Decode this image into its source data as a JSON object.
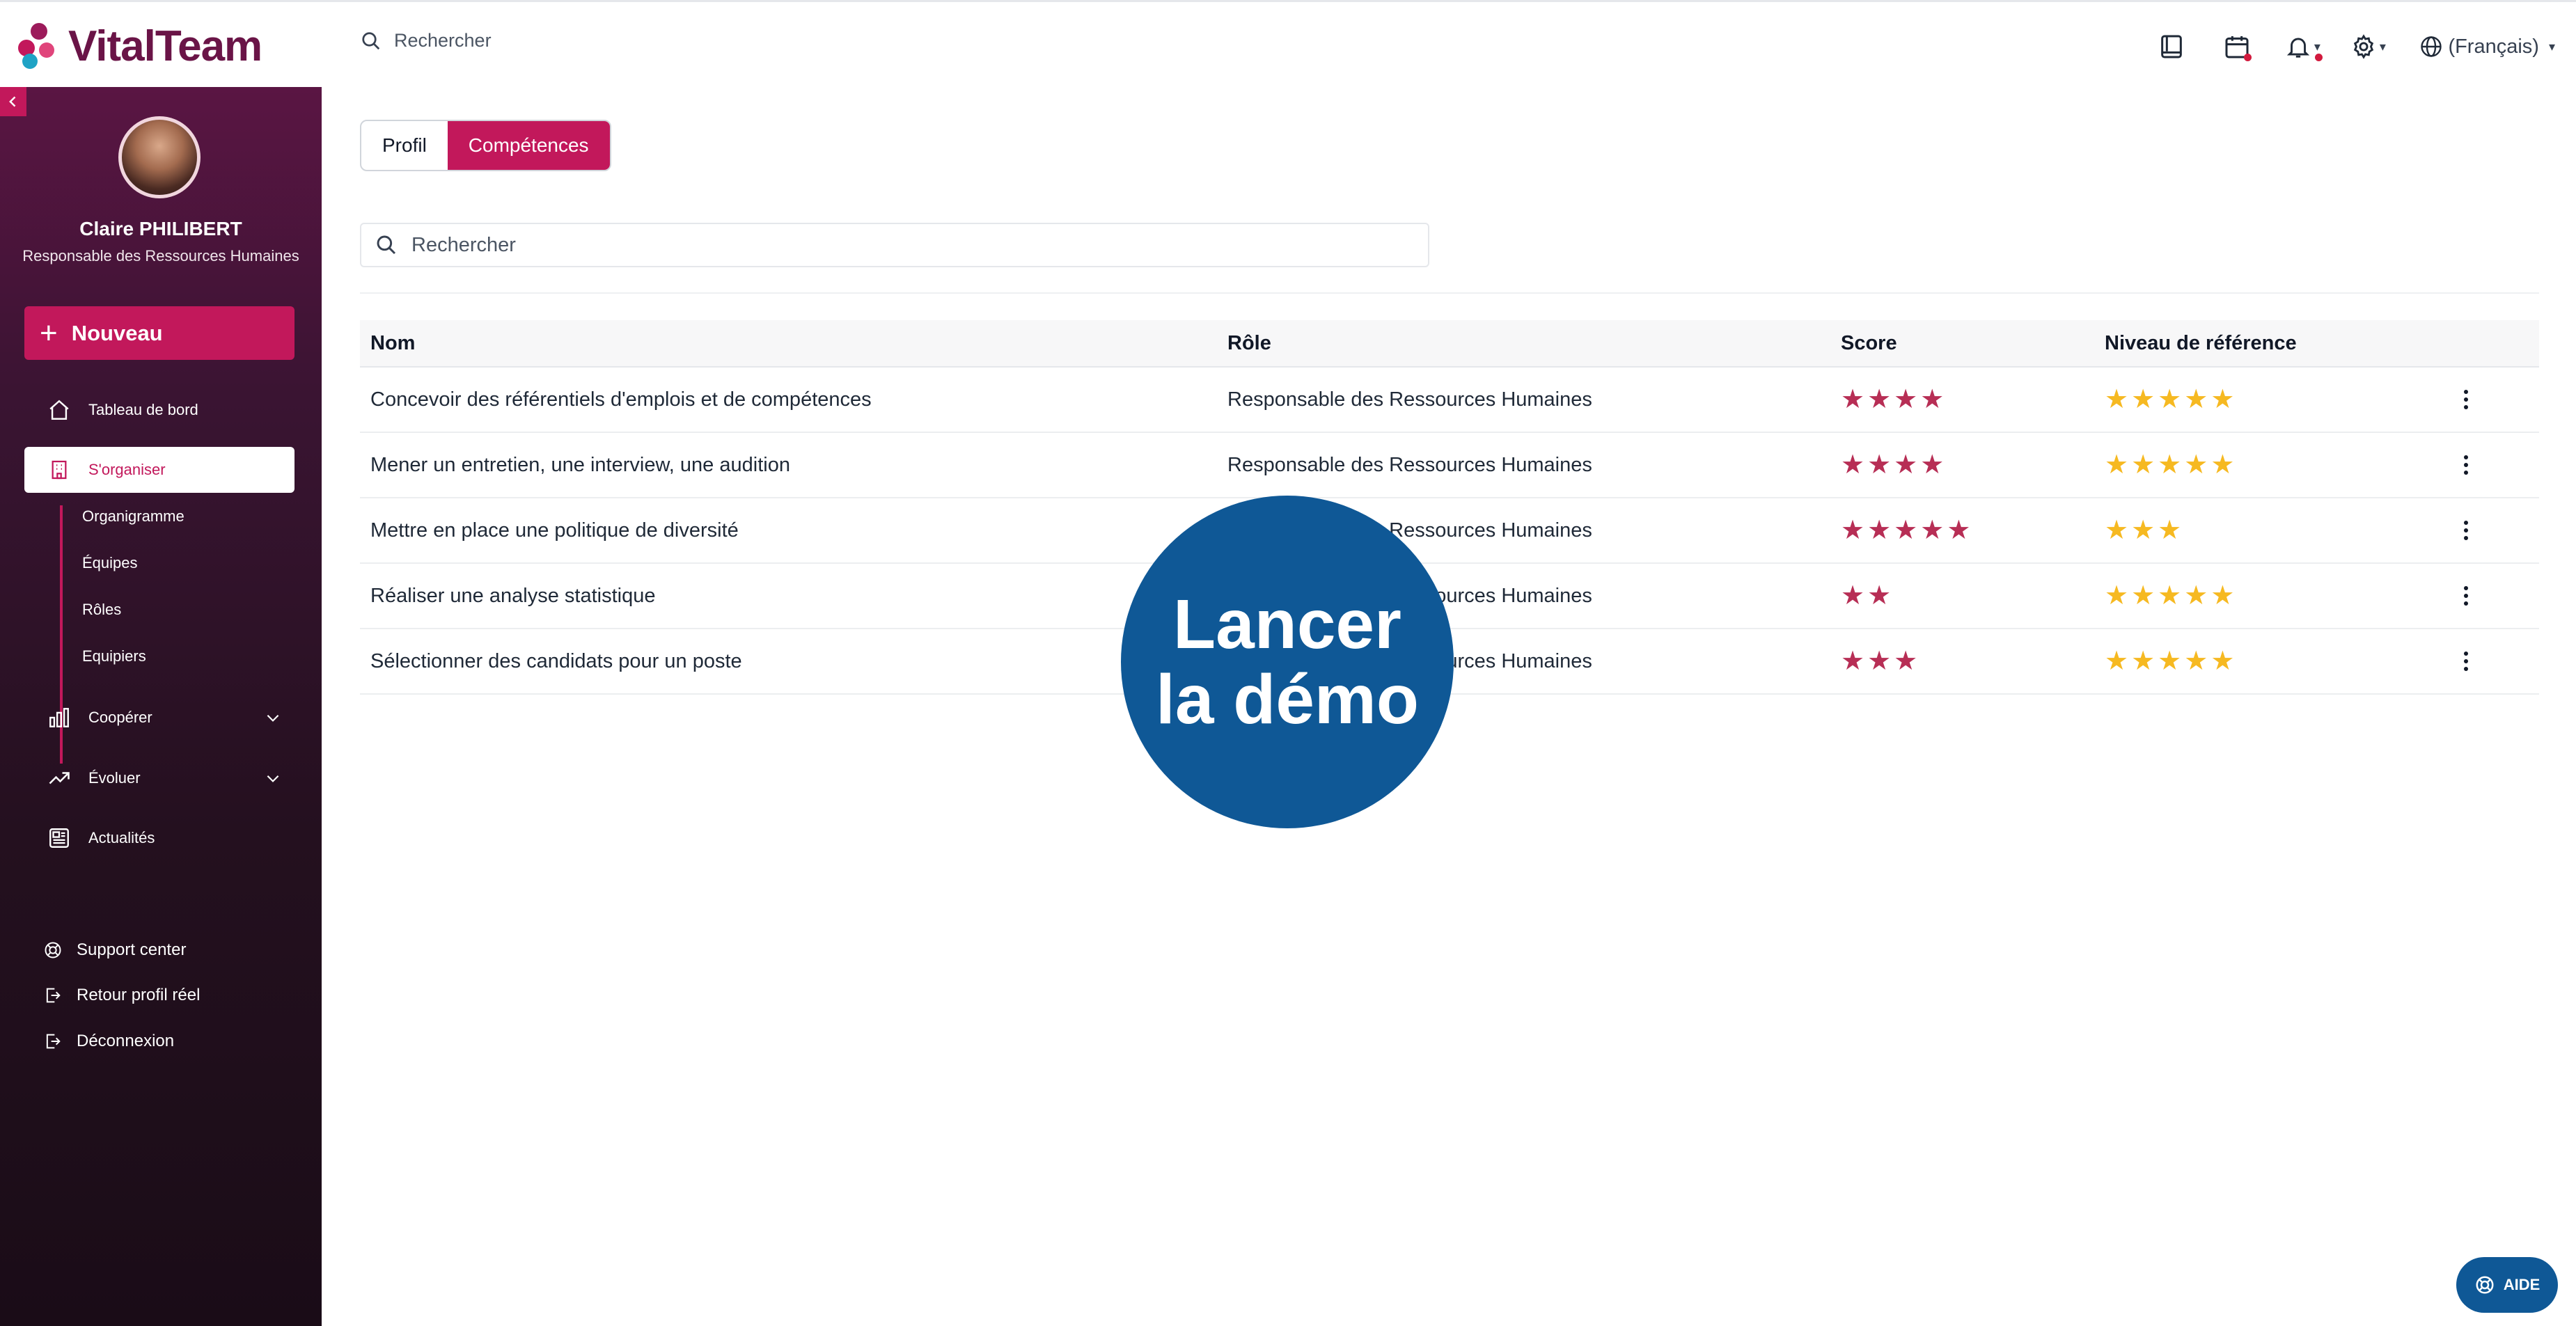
{
  "brand": {
    "name": "VitalTeam",
    "color": "#6a1447",
    "accent": "#c2185b"
  },
  "header": {
    "search_placeholder": "Rechercher",
    "language_label": "(Français)",
    "icons": [
      "book-icon",
      "calendar-icon",
      "bell-icon",
      "gear-icon",
      "globe-icon"
    ]
  },
  "sidebar": {
    "user": {
      "name": "Claire PHILIBERT",
      "role": "Responsable des Ressources Humaines"
    },
    "new_button": "Nouveau",
    "nav": [
      {
        "label": "Tableau de bord",
        "icon": "home-icon"
      },
      {
        "label": "S'organiser",
        "icon": "building-icon",
        "active": true
      },
      {
        "label": "Coopérer",
        "icon": "bar-chart-icon"
      },
      {
        "label": "Évoluer",
        "icon": "trend-icon"
      },
      {
        "label": "Actualités",
        "icon": "news-icon"
      }
    ],
    "subnav": [
      "Organigramme",
      "Équipes",
      "Rôles",
      "Equipiers"
    ],
    "bottom": [
      {
        "label": "Support center",
        "icon": "support-icon"
      },
      {
        "label": "Retour profil réel",
        "icon": "exit-icon"
      },
      {
        "label": "Déconnexion",
        "icon": "logout-icon"
      }
    ]
  },
  "main": {
    "tabs": [
      {
        "label": "Profil"
      },
      {
        "label": "Compétences",
        "active": true
      }
    ],
    "search_placeholder": "Rechercher",
    "columns": [
      "Nom",
      "Rôle",
      "Score",
      "Niveau de référence"
    ],
    "rows": [
      {
        "name": "Concevoir des référentiels d'emplois et de compétences",
        "role": "Responsable des Ressources Humaines",
        "score": 4,
        "reference": 5
      },
      {
        "name": "Mener un entretien, une interview, une audition",
        "role": "Responsable des Ressources Humaines",
        "score": 4,
        "reference": 5
      },
      {
        "name": "Mettre en place une politique de diversité",
        "role": "Responsable des Ressources Humaines",
        "score": 5,
        "reference": 3
      },
      {
        "name": "Réaliser une analyse statistique",
        "role": "Responsable des Ressources Humaines",
        "score": 2,
        "reference": 5
      },
      {
        "name": "Sélectionner des candidats pour un poste",
        "role": "Responsable des Ressources Humaines",
        "score": 3,
        "reference": 5
      }
    ],
    "score_color": "#b72e55",
    "reference_color": "#f6b921"
  },
  "overlay": {
    "line1": "Lancer",
    "line2": "la démo",
    "color": "#0f5896"
  },
  "help_button": "AIDE"
}
